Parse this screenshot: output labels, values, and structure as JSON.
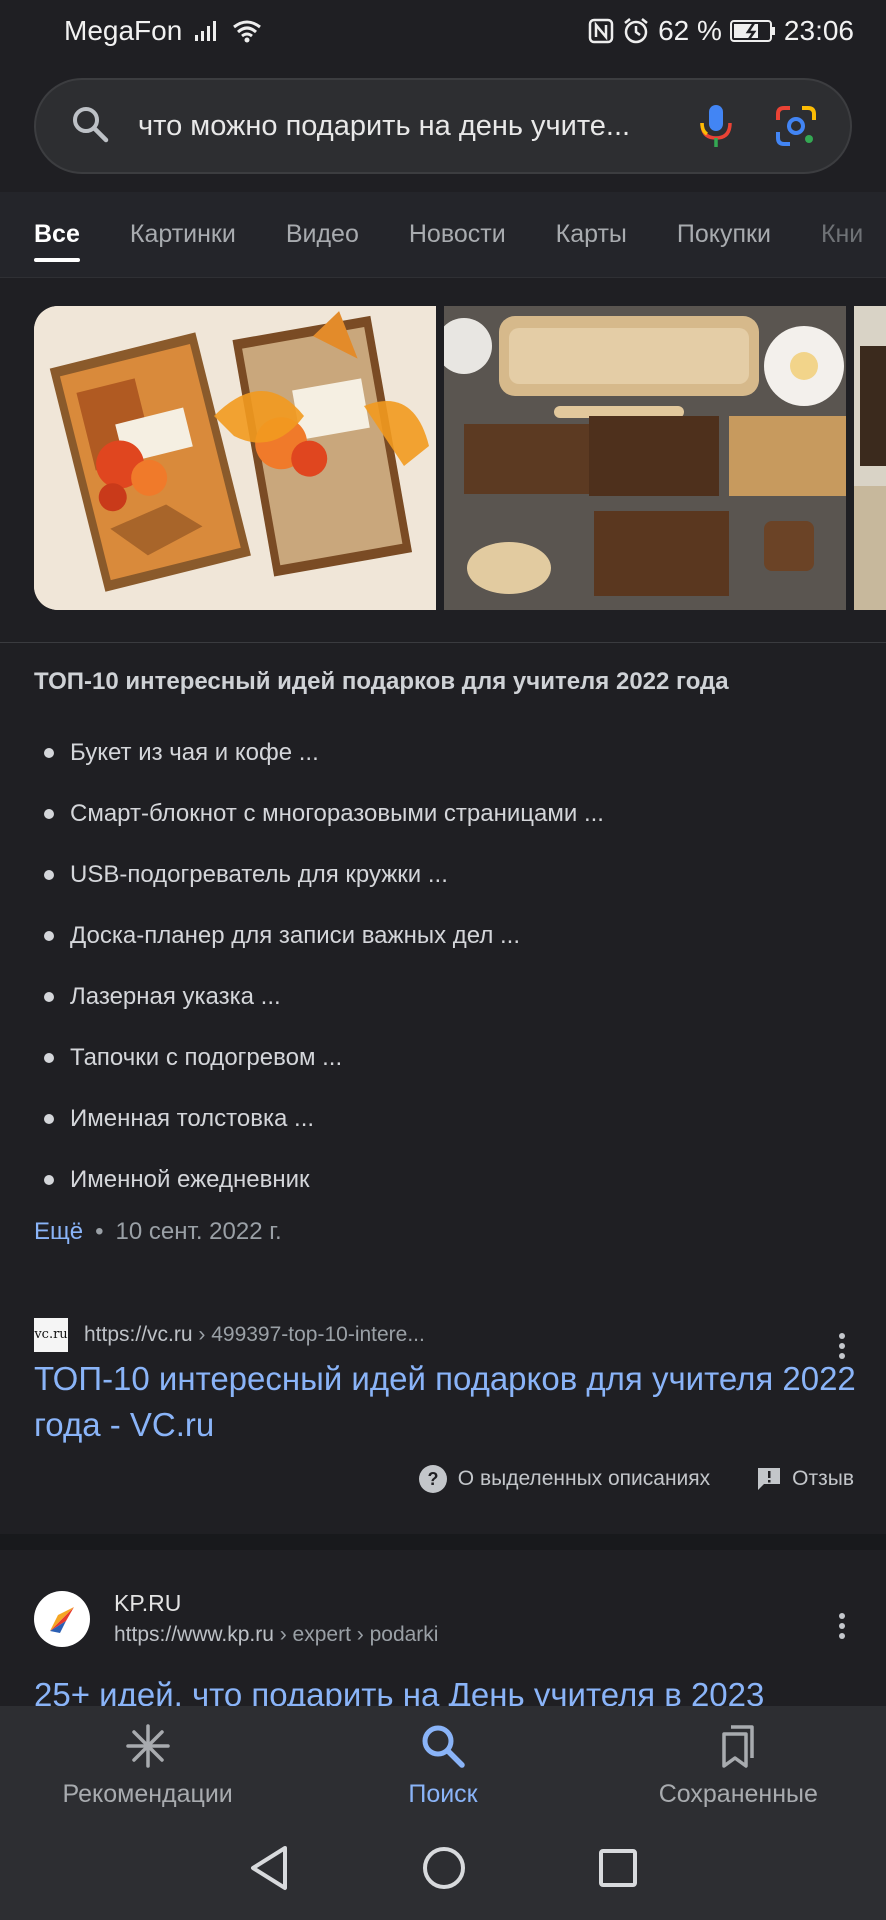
{
  "status_bar": {
    "carrier": "MegaFon",
    "battery_percent": "62 %",
    "time": "23:06",
    "icons": [
      "signal-icon",
      "wifi-icon",
      "nfc-icon",
      "alarm-icon",
      "battery-icon"
    ]
  },
  "search": {
    "query": "что можно подарить на день учите..."
  },
  "tabs": [
    {
      "label": "Все",
      "active": true
    },
    {
      "label": "Картинки"
    },
    {
      "label": "Видео"
    },
    {
      "label": "Новости"
    },
    {
      "label": "Карты"
    },
    {
      "label": "Покупки"
    },
    {
      "label": "Кни"
    }
  ],
  "featured_snippet": {
    "title": "ТОП-10 интересный идей подарков для учителя 2022 года",
    "items": [
      "Букет из чая и кофе ...",
      "Смарт-блокнот с многоразовыми страницами ...",
      "USB-подогреватель для кружки ...",
      "Доска-планер для записи важных дел ...",
      "Лазерная указка ...",
      "Тапочки с подогревом ...",
      "Именная толстовка ...",
      "Именной ежедневник"
    ],
    "more_link": "Ещё",
    "separator": "•",
    "date": "10 сент. 2022 г."
  },
  "result1": {
    "favicon_text": "vc.ru",
    "url": "https://vc.ru",
    "url_path": " › 499397-top-10-intere...",
    "title": "ТОП-10 интересный идей подарков для учителя 2022 года - VC.ru",
    "about_label": "О выделенных описаниях",
    "feedback_label": "Отзыв"
  },
  "result2": {
    "site_name": "KP.RU",
    "url": "https://www.kp.ru",
    "url_path": " › expert › podarki",
    "title": "25+ идей, что подарить на День учителя в 2023"
  },
  "bottom_nav": {
    "items": [
      {
        "label": "Рекомендации",
        "icon": "asterisk-icon"
      },
      {
        "label": "Поиск",
        "icon": "search-icon",
        "active": true
      },
      {
        "label": "Сохраненные",
        "icon": "bookmarks-icon"
      }
    ]
  },
  "colors": {
    "background": "#1f1f23",
    "link": "#8ab4f8",
    "text": "#e3e3e3"
  }
}
